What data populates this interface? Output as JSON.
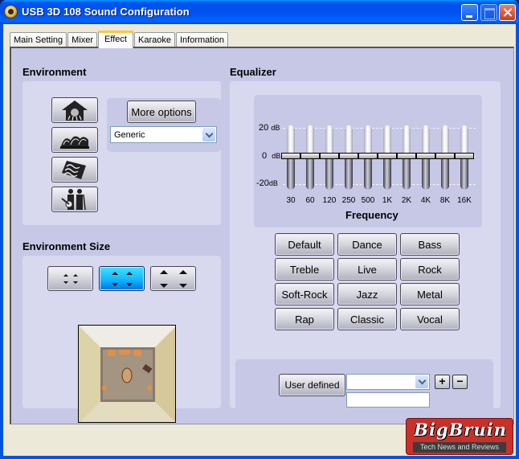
{
  "window": {
    "title": "USB 3D 108 Sound Configuration",
    "icon": "speaker-app-icon",
    "controls": [
      "minimize",
      "maximize",
      "close"
    ]
  },
  "tabs": [
    {
      "label": "Main Setting",
      "active": false
    },
    {
      "label": "Mixer",
      "active": false
    },
    {
      "label": "Effect",
      "active": true
    },
    {
      "label": "Karaoke",
      "active": false
    },
    {
      "label": "Information",
      "active": false
    }
  ],
  "environment": {
    "title": "Environment",
    "icon_buttons": [
      "bathroom-icon",
      "opera-house-icon",
      "carpet-icon",
      "concert-performers-icon"
    ],
    "more_options_label": "More options",
    "preset_selected": "Generic"
  },
  "environment_size": {
    "title": "Environment Size",
    "sizes": [
      "small",
      "medium",
      "large"
    ],
    "selected": "medium"
  },
  "equalizer": {
    "title": "Equalizer",
    "db_labels": {
      "top": "20",
      "mid": "0",
      "bottom": "-20",
      "unit": "dB"
    },
    "range_db": [
      -20,
      20
    ],
    "bands": [
      {
        "freq": "30",
        "value_db": 0
      },
      {
        "freq": "60",
        "value_db": 0
      },
      {
        "freq": "120",
        "value_db": 0
      },
      {
        "freq": "250",
        "value_db": 0
      },
      {
        "freq": "500",
        "value_db": 0
      },
      {
        "freq": "1K",
        "value_db": 0
      },
      {
        "freq": "2K",
        "value_db": 0
      },
      {
        "freq": "4K",
        "value_db": 0
      },
      {
        "freq": "8K",
        "value_db": 0
      },
      {
        "freq": "16K",
        "value_db": 0
      }
    ],
    "axis_title": "Frequency",
    "presets": [
      "Default",
      "Dance",
      "Bass",
      "Treble",
      "Live",
      "Rock",
      "Soft-Rock",
      "Jazz",
      "Metal",
      "Rap",
      "Classic",
      "Vocal"
    ],
    "user_defined_label": "User defined",
    "user_defined_selected": "",
    "user_defined_name": "",
    "add_label": "+",
    "remove_label": "−"
  },
  "watermark": {
    "brand": "BigBruin",
    "tagline": "Tech News and Reviews"
  }
}
